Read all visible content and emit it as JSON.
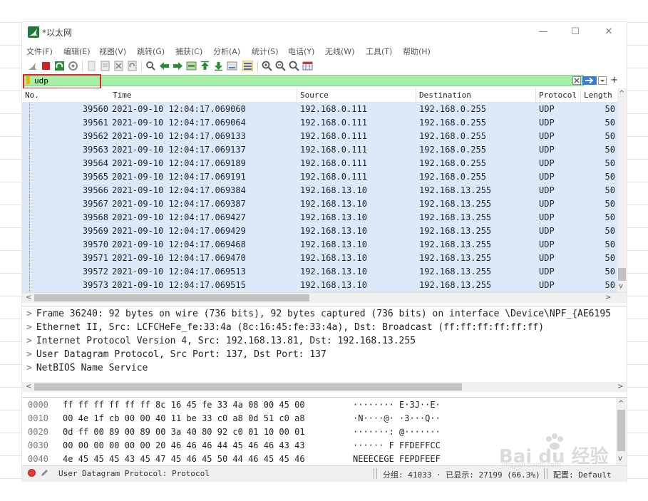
{
  "window": {
    "title": "*以太网",
    "controls": [
      "—",
      "☐",
      "✕"
    ]
  },
  "menu": [
    "文件(F)",
    "编辑(E)",
    "视图(V)",
    "跳转(G)",
    "捕获(C)",
    "分析(A)",
    "统计(S)",
    "电话(Y)",
    "无线(W)",
    "工具(T)",
    "帮助(H)"
  ],
  "toolbar_icons": [
    "shark-start-icon",
    "stop-capture-icon",
    "restart-capture-icon",
    "capture-options-icon",
    "open-file-icon",
    "save-file-icon",
    "close-file-icon",
    "reload-file-icon",
    "find-packet-icon",
    "go-back-icon",
    "go-forward-icon",
    "go-to-packet-icon",
    "go-first-packet-icon",
    "go-last-packet-icon",
    "auto-scroll-icon",
    "colorize-icon",
    "zoom-in-icon",
    "zoom-out-icon",
    "zoom-normal-icon",
    "resize-columns-icon"
  ],
  "filter": {
    "value": "udp",
    "plus": "+"
  },
  "columns": {
    "no": "No.",
    "time": "Time",
    "source": "Source",
    "destination": "Destination",
    "protocol": "Protocol",
    "length": "Length"
  },
  "packets": [
    {
      "no": "39560",
      "time": "2021-09-10 12:04:17.069060",
      "src": "192.168.0.111",
      "dst": "192.168.0.255",
      "proto": "UDP",
      "len": "50"
    },
    {
      "no": "39561",
      "time": "2021-09-10 12:04:17.069064",
      "src": "192.168.0.111",
      "dst": "192.168.0.255",
      "proto": "UDP",
      "len": "50"
    },
    {
      "no": "39562",
      "time": "2021-09-10 12:04:17.069133",
      "src": "192.168.0.111",
      "dst": "192.168.0.255",
      "proto": "UDP",
      "len": "50"
    },
    {
      "no": "39563",
      "time": "2021-09-10 12:04:17.069137",
      "src": "192.168.0.111",
      "dst": "192.168.0.255",
      "proto": "UDP",
      "len": "50"
    },
    {
      "no": "39564",
      "time": "2021-09-10 12:04:17.069189",
      "src": "192.168.0.111",
      "dst": "192.168.0.255",
      "proto": "UDP",
      "len": "50"
    },
    {
      "no": "39565",
      "time": "2021-09-10 12:04:17.069191",
      "src": "192.168.0.111",
      "dst": "192.168.0.255",
      "proto": "UDP",
      "len": "50"
    },
    {
      "no": "39566",
      "time": "2021-09-10 12:04:17.069384",
      "src": "192.168.13.10",
      "dst": "192.168.13.255",
      "proto": "UDP",
      "len": "50"
    },
    {
      "no": "39567",
      "time": "2021-09-10 12:04:17.069387",
      "src": "192.168.13.10",
      "dst": "192.168.13.255",
      "proto": "UDP",
      "len": "50"
    },
    {
      "no": "39568",
      "time": "2021-09-10 12:04:17.069427",
      "src": "192.168.13.10",
      "dst": "192.168.13.255",
      "proto": "UDP",
      "len": "50"
    },
    {
      "no": "39569",
      "time": "2021-09-10 12:04:17.069429",
      "src": "192.168.13.10",
      "dst": "192.168.13.255",
      "proto": "UDP",
      "len": "50"
    },
    {
      "no": "39570",
      "time": "2021-09-10 12:04:17.069468",
      "src": "192.168.13.10",
      "dst": "192.168.13.255",
      "proto": "UDP",
      "len": "50"
    },
    {
      "no": "39571",
      "time": "2021-09-10 12:04:17.069470",
      "src": "192.168.13.10",
      "dst": "192.168.13.255",
      "proto": "UDP",
      "len": "50"
    },
    {
      "no": "39572",
      "time": "2021-09-10 12:04:17.069513",
      "src": "192.168.13.10",
      "dst": "192.168.13.255",
      "proto": "UDP",
      "len": "50"
    },
    {
      "no": "39573",
      "time": "2021-09-10 12:04:17.069515",
      "src": "192.168.13.10",
      "dst": "192.168.13.255",
      "proto": "UDP",
      "len": "50"
    }
  ],
  "details": [
    "Frame 36240: 92 bytes on wire (736 bits), 92 bytes captured (736 bits) on interface \\Device\\NPF_{AE6195",
    "Ethernet II, Src: LCFCHeFe_fe:33:4a (8c:16:45:fe:33:4a), Dst: Broadcast (ff:ff:ff:ff:ff:ff)",
    "Internet Protocol Version 4, Src: 192.168.13.81, Dst: 192.168.13.255",
    "User Datagram Protocol, Src Port: 137, Dst Port: 137",
    "NetBIOS Name Service"
  ],
  "bytes": [
    {
      "offset": "0000",
      "hex": "ff ff ff ff ff ff 8c 16  45 fe 33 4a 08 00 45 00",
      "ascii": "········ E·3J··E·"
    },
    {
      "offset": "0010",
      "hex": "00 4e 1f cb 00 00 40 11  be 33 c0 a8 0d 51 c0 a8",
      "ascii": "·N····@· ·3···Q··"
    },
    {
      "offset": "0020",
      "hex": "0d ff 00 89 00 89 00 3a  40 80 92 c0 01 10 00 01",
      "ascii": "·······: @·······"
    },
    {
      "offset": "0030",
      "hex": "00 00 00 00 00 00 20 46  46 46 44 45 46 46 43 43",
      "ascii": "······ F FFDEFFCC"
    },
    {
      "offset": "0040",
      "hex": "4e 45 45 45 43 45 47 45  46 45 50 44 46 45 45 46",
      "ascii": "NEEECEGE FEPDFEEF"
    }
  ],
  "status": {
    "field": "User Datagram Protocol: Protocol",
    "counts": "分组: 41033 · 已显示: 27199 (66.3%)",
    "profile": "配置: Default"
  },
  "watermark": {
    "text": "Bai du 经验",
    "sub": "jingyan.baidu.com"
  },
  "colors": {
    "row_bg": "#dbe9f9",
    "filter_bg": "#a6f0a6",
    "highlight": "#d8262b"
  }
}
